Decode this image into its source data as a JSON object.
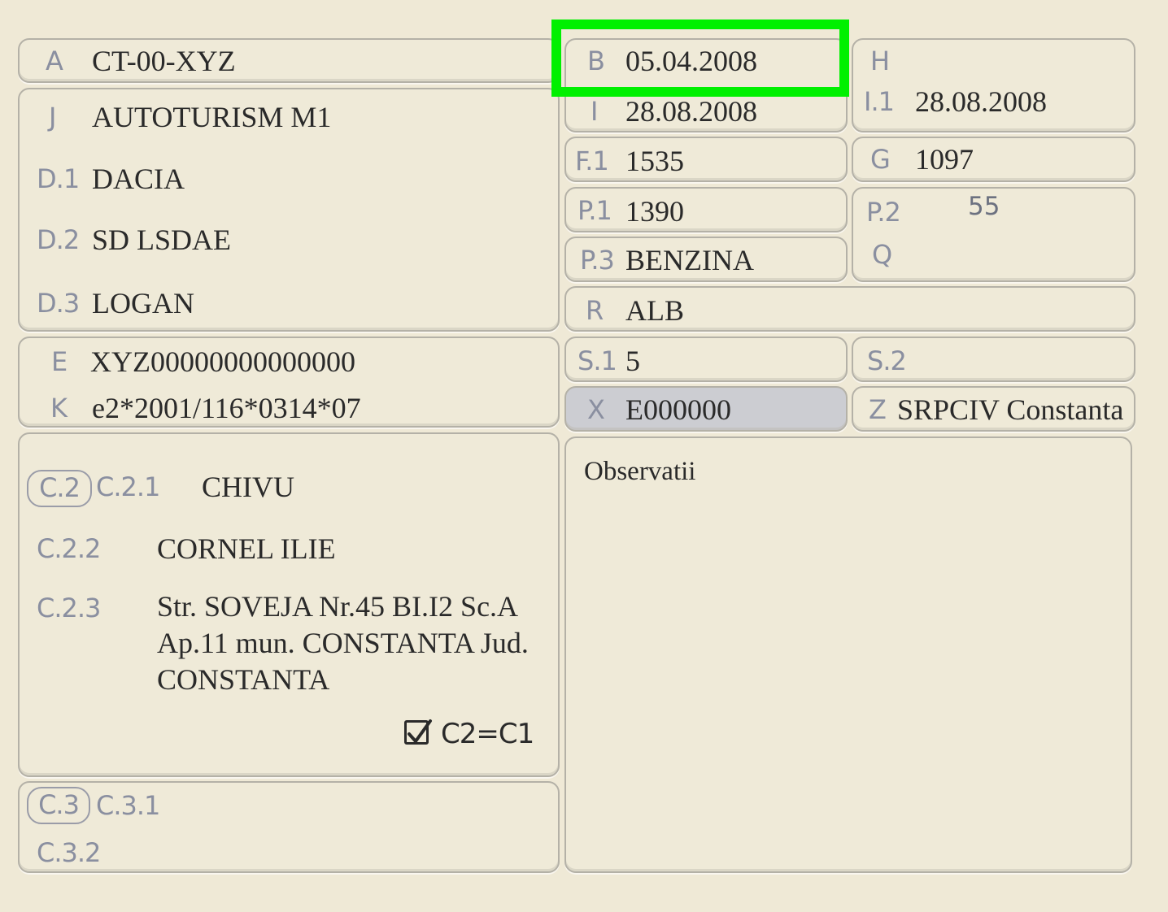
{
  "fields": {
    "A": {
      "label": "A",
      "value": "CT-00-XYZ"
    },
    "B": {
      "label": "B",
      "value": "05.04.2008"
    },
    "I": {
      "label": "I",
      "value": "28.08.2008"
    },
    "H": {
      "label": "H",
      "value": ""
    },
    "I1": {
      "label": "I.1",
      "value": "28.08.2008"
    },
    "J": {
      "label": "J",
      "value": "AUTOTURISM M1"
    },
    "D1": {
      "label": "D.1",
      "value": "DACIA"
    },
    "D2": {
      "label": "D.2",
      "value": "SD LSDAE"
    },
    "D3": {
      "label": "D.3",
      "value": "LOGAN"
    },
    "F1": {
      "label": "F.1",
      "value": "1535"
    },
    "G": {
      "label": "G",
      "value": "1097"
    },
    "P1": {
      "label": "P.1",
      "value": "1390"
    },
    "P2": {
      "label": "P.2",
      "value": "55"
    },
    "Q": {
      "label": "Q",
      "value": ""
    },
    "P3": {
      "label": "P.3",
      "value": "BENZINA"
    },
    "R": {
      "label": "R",
      "value": "ALB"
    },
    "E": {
      "label": "E",
      "value": "XYZ00000000000000"
    },
    "K": {
      "label": "K",
      "value": "e2*2001/116*0314*07"
    },
    "S1": {
      "label": "S.1",
      "value": "5"
    },
    "S2": {
      "label": "S.2",
      "value": ""
    },
    "X": {
      "label": "X",
      "value": "E000000"
    },
    "Z": {
      "label": "Z",
      "value": "SRPCIV Constanta"
    },
    "C2_section": {
      "label": "C.2"
    },
    "C21": {
      "label": "C.2.1",
      "value": "CHIVU"
    },
    "C22": {
      "label": "C.2.2",
      "value": "CORNEL ILIE"
    },
    "C23": {
      "label": "C.2.3",
      "lines": [
        "Str. SOVEJA Nr.45 BI.I2 Sc.A",
        "Ap.11 mun. CONSTANTA Jud.",
        "CONSTANTA"
      ]
    },
    "C2_eq_C1": {
      "label": "C2=C1",
      "checked": true
    },
    "C3_section": {
      "label": "C.3"
    },
    "C31": {
      "label": "C.3.1",
      "value": ""
    },
    "C32": {
      "label": "C.3.2",
      "value": ""
    }
  },
  "observations": {
    "label": "Observatii",
    "value": ""
  },
  "colors": {
    "background": "#efe9d6",
    "border": "#b4b1a7",
    "label": "#8a8fa0",
    "value": "#2a2a2a",
    "x_fill": "#cccdd2",
    "highlight": "#00f000"
  }
}
